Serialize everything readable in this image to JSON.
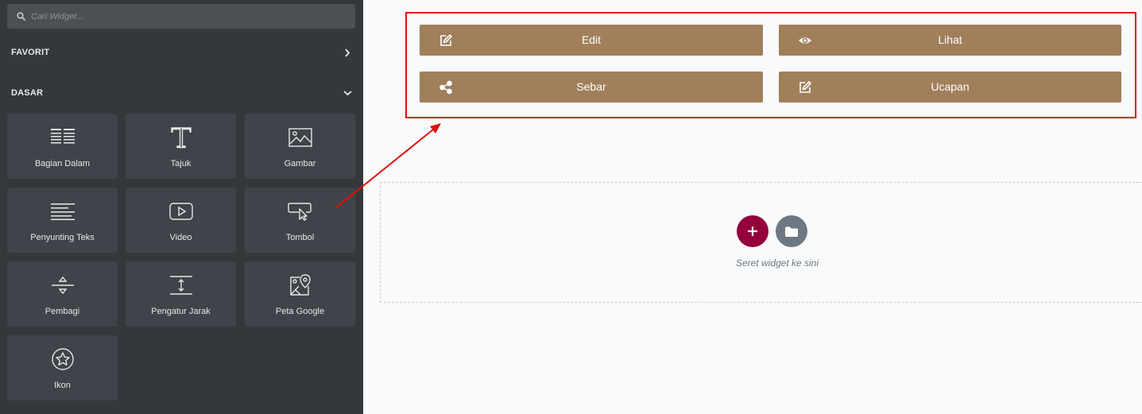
{
  "panel": {
    "search": {
      "placeholder": "Cari Widget..."
    },
    "sections": [
      {
        "label": "FAVORIT",
        "state": "collapsed",
        "icon": "chevron-right-icon"
      },
      {
        "label": "DASAR",
        "state": "expanded",
        "icon": "chevron-down-icon"
      }
    ],
    "widgets": [
      {
        "label": "Bagian Dalam",
        "icon": "inner-section-icon"
      },
      {
        "label": "Tajuk",
        "icon": "heading-icon"
      },
      {
        "label": "Gambar",
        "icon": "image-icon"
      },
      {
        "label": "Penyunting Teks",
        "icon": "text-editor-icon"
      },
      {
        "label": "Video",
        "icon": "video-icon"
      },
      {
        "label": "Tombol",
        "icon": "button-icon"
      },
      {
        "label": "Pembagi",
        "icon": "divider-icon"
      },
      {
        "label": "Pengatur Jarak",
        "icon": "spacer-icon"
      },
      {
        "label": "Peta Google",
        "icon": "google-maps-icon"
      },
      {
        "label": "Ikon",
        "icon": "star-icon"
      }
    ]
  },
  "canvas": {
    "buttons": [
      {
        "label": "Edit",
        "icon": "edit-icon"
      },
      {
        "label": "Lihat",
        "icon": "eye-icon"
      },
      {
        "label": "Sebar",
        "icon": "share-icon"
      },
      {
        "label": "Ucapan",
        "icon": "edit-icon"
      }
    ],
    "drop_zone": {
      "text": "Seret widget ke sini"
    }
  },
  "colors": {
    "panel_bg": "#34383c",
    "tile_bg": "#404349",
    "button_bg": "#a07f5a",
    "highlight": "#e20d0d",
    "add_button": "#93003c",
    "template_button": "#6d7882"
  }
}
